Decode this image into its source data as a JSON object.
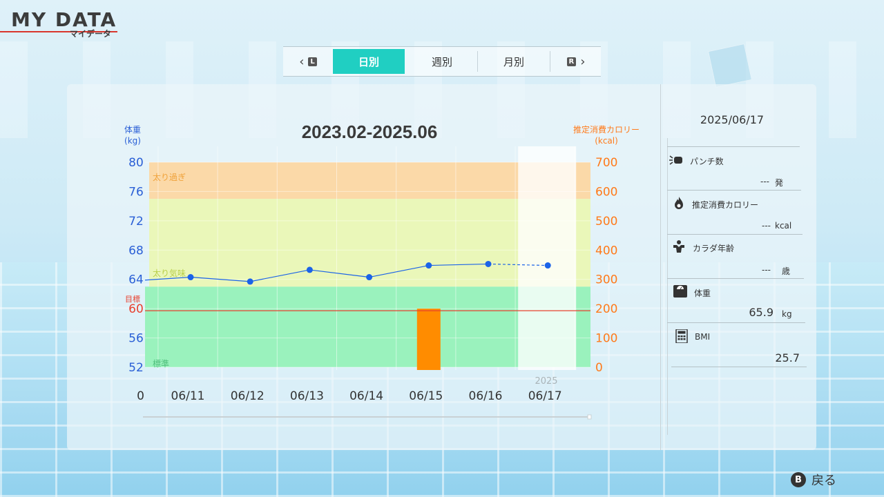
{
  "header": {
    "title": "MY DATA",
    "subtitle": "マイデータ"
  },
  "tabs": {
    "prev_key": "L",
    "next_key": "R",
    "items": [
      {
        "label": "日別",
        "active": true
      },
      {
        "label": "週別",
        "active": false
      },
      {
        "label": "月別",
        "active": false
      }
    ]
  },
  "chart_data": {
    "type": "line",
    "title": "2023.02-2025.06",
    "left_axis_label": "体重",
    "left_axis_unit": "(kg)",
    "right_axis_label": "推定消費カロリー",
    "right_axis_unit": "(kcal)",
    "left_ticks": [
      "80",
      "76",
      "72",
      "68",
      "64",
      "60",
      "56",
      "52"
    ],
    "right_ticks": [
      "700",
      "600",
      "500",
      "400",
      "300",
      "200",
      "100",
      "0"
    ],
    "ylim_left": [
      52,
      80
    ],
    "ylim_right": [
      0,
      700
    ],
    "target": {
      "label": "目標",
      "value": 60
    },
    "zones": [
      {
        "label": "太り過ぎ",
        "from": 75,
        "to": 80,
        "color": "#fbd9a8"
      },
      {
        "label": "太り気味",
        "from": 63,
        "to": 75,
        "color": "#eaf7b9"
      },
      {
        "label": "標準",
        "from": 52,
        "to": 63,
        "color": "#9af2bd"
      }
    ],
    "x_partial_label": "0",
    "categories": [
      "06/11",
      "06/12",
      "06/13",
      "06/14",
      "06/15",
      "06/16",
      "06/17"
    ],
    "year_label": "2025",
    "series": [
      {
        "axis": "left",
        "type": "line",
        "values": [
          64.3,
          63.7,
          65.3,
          64.3,
          65.9,
          66.1,
          65.9
        ]
      },
      {
        "axis": "right",
        "type": "bar",
        "values": [
          0,
          0,
          0,
          0,
          200,
          0,
          0
        ]
      }
    ],
    "colors": {
      "line": "#1b63e8",
      "bar": "#ff8c00",
      "target": "#e8402e",
      "left_axis": "#2a5fd6",
      "right_axis": "#ff7a1a"
    }
  },
  "side": {
    "date": "2025/06/17",
    "items": [
      {
        "icon": "punch-icon",
        "label": "パンチ数",
        "value": "---",
        "unit": "発"
      },
      {
        "icon": "flame-icon",
        "label": "推定消費カロリー",
        "value": "---",
        "unit": "kcal"
      },
      {
        "icon": "muscle-icon",
        "label": "カラダ年齢",
        "value": "---",
        "unit": "歳"
      },
      {
        "icon": "scale-icon",
        "label": "体重",
        "value": "65.9",
        "unit": "kg"
      },
      {
        "icon": "calculator-icon",
        "label": "BMI",
        "value": "25.7",
        "unit": ""
      }
    ]
  },
  "footer": {
    "back_key": "B",
    "back_label": "戻る"
  }
}
